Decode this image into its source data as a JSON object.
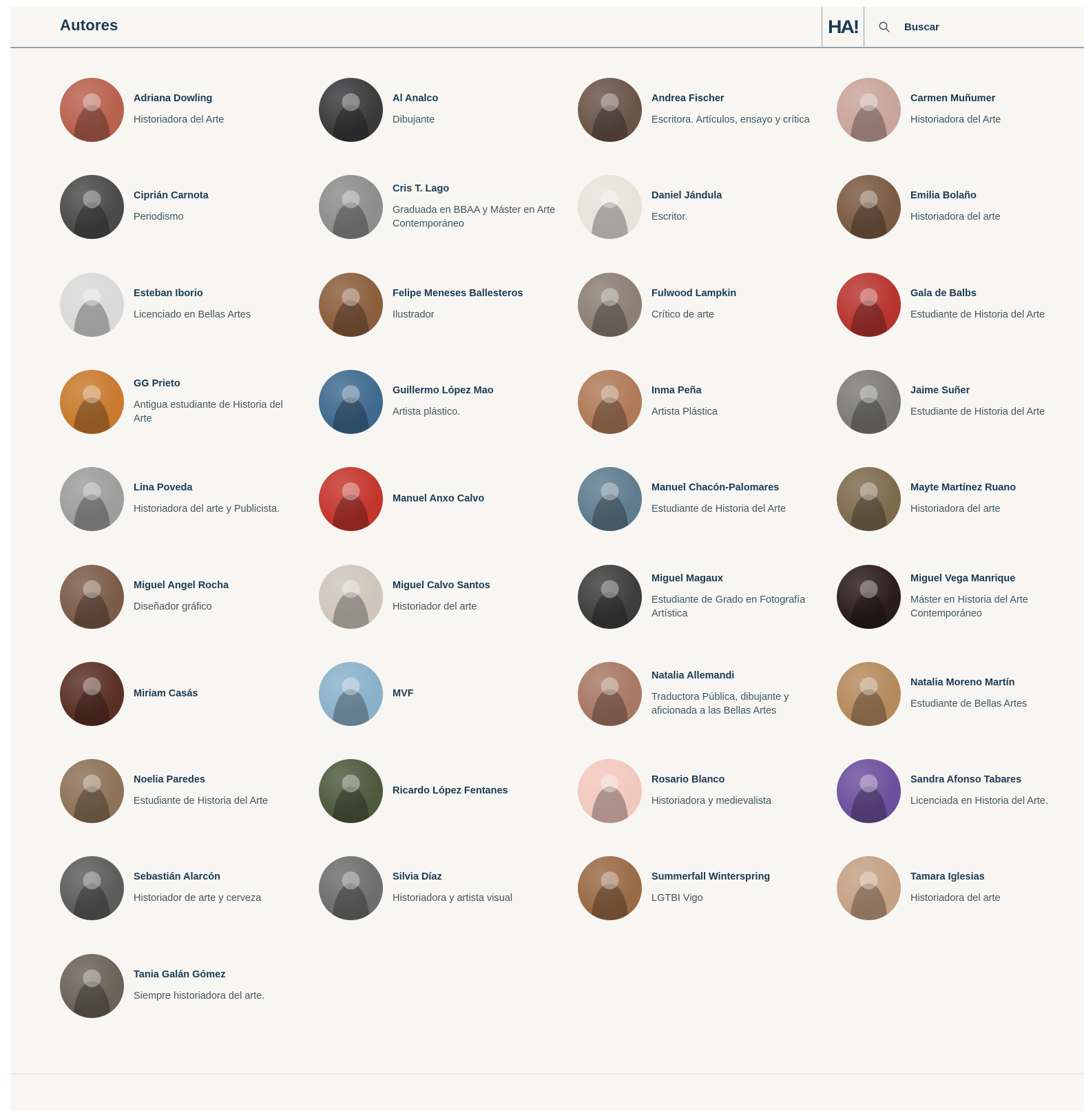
{
  "header": {
    "title": "Autores",
    "logo_text": "HA!",
    "search_label": "Buscar"
  },
  "authors": [
    {
      "name": "Adriana Dowling",
      "role": "Historiadora del Arte",
      "avatar_color": "#b8614d"
    },
    {
      "name": "Al Analco",
      "role": "Dibujante",
      "avatar_color": "#3a3a3c"
    },
    {
      "name": "Andrea Fischer",
      "role": "Escritora. Artículos, ensayo y crítica",
      "avatar_color": "#6a5448"
    },
    {
      "name": "Carmen Muñumer",
      "role": "Historiadora del Arte",
      "avatar_color": "#c9a49a"
    },
    {
      "name": "Ciprián Carnota",
      "role": "Periodismo",
      "avatar_color": "#4a4a4a"
    },
    {
      "name": "Cris T. Lago",
      "role": "Graduada en BBAA y Máster en Arte Contemporáneo",
      "avatar_color": "#8d8d8d"
    },
    {
      "name": "Daniel Jándula",
      "role": "Escritor.",
      "avatar_color": "#e8e2da"
    },
    {
      "name": "Emilia Bolaño",
      "role": "Historiadora del arte",
      "avatar_color": "#7a5a42"
    },
    {
      "name": "Esteban Iborio",
      "role": "Licenciado en Bellas Artes",
      "avatar_color": "#d9d9d9"
    },
    {
      "name": "Felipe Meneses Ballesteros",
      "role": "Ilustrador",
      "avatar_color": "#8b5e3c"
    },
    {
      "name": "Fulwood Lampkin",
      "role": "Crítico de arte",
      "avatar_color": "#8c7f73"
    },
    {
      "name": "Gala de Balbs",
      "role": "Estudiante de Historia del Arte",
      "avatar_color": "#b8342e"
    },
    {
      "name": "GG Prieto",
      "role": "Antigua estudiante de Historia del Arte",
      "avatar_color": "#c97a2e"
    },
    {
      "name": "Guillermo López Mao",
      "role": "Artista plástico.",
      "avatar_color": "#3f6a8f"
    },
    {
      "name": "Inma Peña",
      "role": "Artista Plástica",
      "avatar_color": "#b07a58"
    },
    {
      "name": "Jaime Suñer",
      "role": "Estudiante de Historia del Arte",
      "avatar_color": "#7c7b78"
    },
    {
      "name": "Lina Poveda",
      "role": "Historiadora del arte y Publicista.",
      "avatar_color": "#9d9d9d"
    },
    {
      "name": "Manuel Anxo Calvo",
      "role": "",
      "avatar_color": "#c4352c"
    },
    {
      "name": "Manuel Chacón-Palomares",
      "role": "Estudiante de Historia del Arte",
      "avatar_color": "#5f7c8e"
    },
    {
      "name": "Mayte Martínez Ruano",
      "role": "Historiadora del arte",
      "avatar_color": "#7d6b4c"
    },
    {
      "name": "Miguel Angel Rocha",
      "role": "Diseñador gráfico",
      "avatar_color": "#7b5b48"
    },
    {
      "name": "Miguel Calvo Santos",
      "role": "Historiador del arte",
      "avatar_color": "#cfc6bb"
    },
    {
      "name": "Miguel Magaux",
      "role": "Estudiante de Grado en Fotografía Artística",
      "avatar_color": "#3d3d3d"
    },
    {
      "name": "Miguel Vega Manrique",
      "role": "Máster en Historia del Arte Contemporáneo",
      "avatar_color": "#2a1b1e"
    },
    {
      "name": "Miriam Casás",
      "role": "",
      "avatar_color": "#5a2f24"
    },
    {
      "name": "MVF",
      "role": "",
      "avatar_color": "#8ab1c9"
    },
    {
      "name": "Natalia Allemandi",
      "role": "Traductora Pública, dibujante y aficionada a las Bellas Artes",
      "avatar_color": "#a87864"
    },
    {
      "name": "Natalia Moreno Martín",
      "role": "Estudiante de Bellas Artes",
      "avatar_color": "#b58a5d"
    },
    {
      "name": "Noelia Paredes",
      "role": "Estudiante de Historia del Arte",
      "avatar_color": "#8d7257"
    },
    {
      "name": "Ricardo López Fentanes",
      "role": "",
      "avatar_color": "#4d5a3e"
    },
    {
      "name": "Rosario Blanco",
      "role": "Historiadora y medievalista",
      "avatar_color": "#f2c8bd"
    },
    {
      "name": "Sandra Afonso Tabares",
      "role": "Licenciada en Historia del Arte.",
      "avatar_color": "#6c4f9c"
    },
    {
      "name": "Sebastián Alarcón",
      "role": "Historiador de arte y cerveza",
      "avatar_color": "#5c5c5c"
    },
    {
      "name": "Silvia Díaz",
      "role": "Historiadora y artista visual",
      "avatar_color": "#6e6e6e"
    },
    {
      "name": "Summerfall Winterspring",
      "role": "LGTBI Vigo",
      "avatar_color": "#9a6a45"
    },
    {
      "name": "Tamara Iglesias",
      "role": "Historiadora del arte",
      "avatar_color": "#c4a184"
    },
    {
      "name": "Tania Galán Gómez",
      "role": "Siempre historiadora del arte.",
      "avatar_color": "#6b6257"
    }
  ]
}
